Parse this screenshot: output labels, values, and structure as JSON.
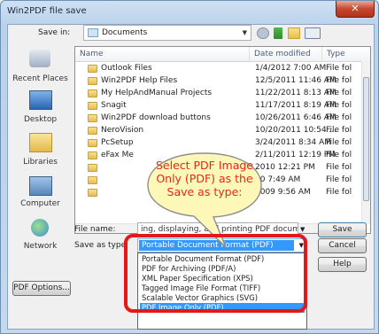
{
  "window": {
    "title": "Win2PDF file save",
    "close_glyph": "✕"
  },
  "save_in": {
    "label": "Save in:",
    "value": "Documents"
  },
  "places": [
    {
      "label": "Recent Places",
      "icon": "recent-places-icon"
    },
    {
      "label": "Desktop",
      "icon": "desktop-icon"
    },
    {
      "label": "Libraries",
      "icon": "libraries-icon"
    },
    {
      "label": "Computer",
      "icon": "computer-icon"
    },
    {
      "label": "Network",
      "icon": "network-icon"
    }
  ],
  "columns": {
    "name": "Name",
    "date": "Date modified",
    "type": "Type"
  },
  "files": [
    {
      "name": "Outlook Files",
      "date": "1/4/2012 7:00 AM",
      "type": "File fol"
    },
    {
      "name": "Win2PDF Help Files",
      "date": "12/5/2011 11:46 AM",
      "type": "File fol"
    },
    {
      "name": "My HelpAndManual Projects",
      "date": "11/22/2011 8:13 AM",
      "type": "File fol"
    },
    {
      "name": "Snagit",
      "date": "11/17/2011 8:19 AM",
      "type": "File fol"
    },
    {
      "name": "Win2PDF download buttons",
      "date": "10/26/2011 6:46 AM",
      "type": "File fol"
    },
    {
      "name": "NeroVision",
      "date": "10/20/2011 10:54 ...",
      "type": "File fol"
    },
    {
      "name": "PcSetup",
      "date": "3/24/2011 8:34 AM",
      "type": "File fol"
    },
    {
      "name": "eFax Me",
      "date": "2/11/2011 12:19 PM",
      "type": "File fol"
    },
    {
      "name": "",
      "date": "2010 12:21 PM",
      "type": "File fol"
    },
    {
      "name": "",
      "date": "10 7:49 AM",
      "type": "File fol"
    },
    {
      "name": "",
      "date": "2009 9:56 AM",
      "type": "File fol"
    }
  ],
  "file_name": {
    "label": "File name:",
    "value": "ing, displaying, and printing PDF documents.pdf"
  },
  "save_as_type": {
    "label": "Save as type:",
    "selected": "Portable Document Format (PDF)",
    "options": [
      "Portable Document Format (PDF)",
      "PDF for Archiving (PDF/A)",
      "XML Paper Specification (XPS)",
      "Tagged Image File Format (TIFF)",
      "Scalable Vector Graphics (SVG)",
      "PDF Image Only (PDF)"
    ],
    "highlighted_index": 5
  },
  "buttons": {
    "save": "Save",
    "cancel": "Cancel",
    "help": "Help",
    "pdf_options": "PDF Options..."
  },
  "callout": {
    "lines": [
      "Select PDF Image",
      "Only (PDF) as the",
      "Save as type:"
    ]
  },
  "colors": {
    "highlight": "#3399ff",
    "callout_text": "#e8261c",
    "annotation_border": "#e3181b",
    "callout_fill": "#fdf8b8"
  }
}
